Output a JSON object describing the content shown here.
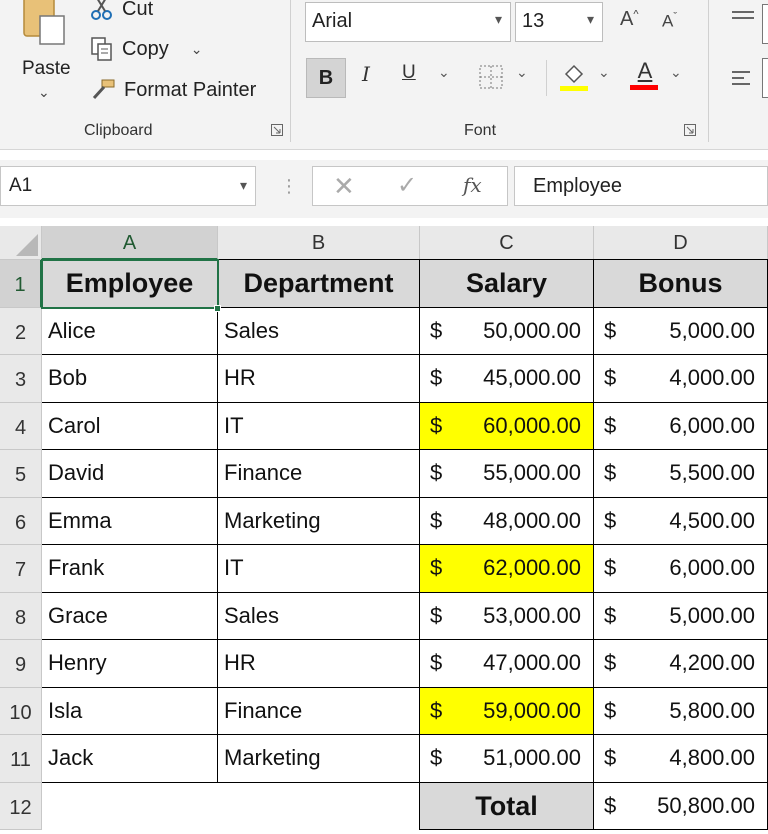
{
  "ribbon": {
    "clipboard": {
      "paste_label": "Paste",
      "cut_label": "Cut",
      "copy_label": "Copy",
      "format_painter_label": "Format Painter",
      "group_label": "Clipboard"
    },
    "font": {
      "font_name": "Arial",
      "font_size": "13",
      "increase_size_glyph": "A",
      "decrease_size_glyph": "A",
      "bold_label": "B",
      "italic_label": "I",
      "underline_label": "U",
      "font_color_label": "A",
      "group_label": "Font",
      "fill_color": "#FFFF00",
      "font_color": "#FF0000"
    }
  },
  "formula_bar": {
    "name_box": "A1",
    "fx_label": "fx",
    "formula": "Employee"
  },
  "sheet": {
    "column_headers": [
      "A",
      "B",
      "C",
      "D"
    ],
    "selected_cell": "A1",
    "row_numbers": [
      "1",
      "2",
      "3",
      "4",
      "5",
      "6",
      "7",
      "8",
      "9",
      "10",
      "11",
      "12"
    ],
    "header_row": [
      "Employee",
      "Department",
      "Salary",
      "Bonus"
    ],
    "rows": [
      {
        "employee": "Alice",
        "department": "Sales",
        "salary": "50,000.00",
        "bonus": "5,000.00",
        "highlight": false
      },
      {
        "employee": "Bob",
        "department": "HR",
        "salary": "45,000.00",
        "bonus": "4,000.00",
        "highlight": false
      },
      {
        "employee": "Carol",
        "department": "IT",
        "salary": "60,000.00",
        "bonus": "6,000.00",
        "highlight": true
      },
      {
        "employee": "David",
        "department": "Finance",
        "salary": "55,000.00",
        "bonus": "5,500.00",
        "highlight": false
      },
      {
        "employee": "Emma",
        "department": "Marketing",
        "salary": "48,000.00",
        "bonus": "4,500.00",
        "highlight": false
      },
      {
        "employee": "Frank",
        "department": "IT",
        "salary": "62,000.00",
        "bonus": "6,000.00",
        "highlight": true
      },
      {
        "employee": "Grace",
        "department": "Sales",
        "salary": "53,000.00",
        "bonus": "5,000.00",
        "highlight": false
      },
      {
        "employee": "Henry",
        "department": "HR",
        "salary": "47,000.00",
        "bonus": "4,200.00",
        "highlight": false
      },
      {
        "employee": "Isla",
        "department": "Finance",
        "salary": "59,000.00",
        "bonus": "5,800.00",
        "highlight": true
      },
      {
        "employee": "Jack",
        "department": "Marketing",
        "salary": "51,000.00",
        "bonus": "4,800.00",
        "highlight": false
      }
    ],
    "currency_symbol": "$",
    "total_label": "Total",
    "total_value": "50,800.00",
    "highlight_color": "#FFFF00",
    "selection_color": "#217346"
  }
}
